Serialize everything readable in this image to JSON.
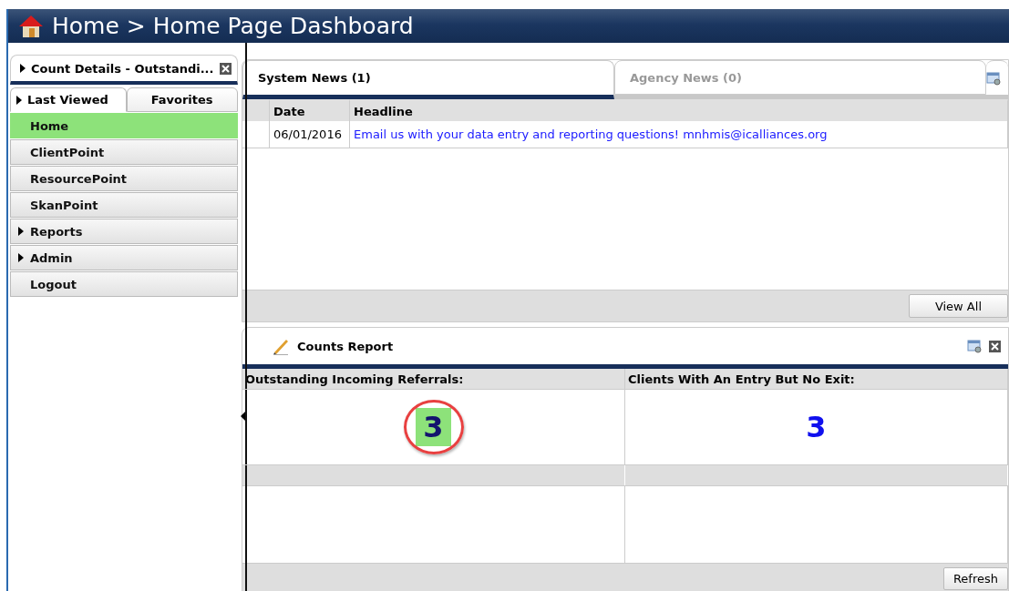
{
  "header": {
    "crumbs": [
      "Home",
      "Home Page Dashboard"
    ],
    "separator": ">"
  },
  "sidebar": {
    "recent": {
      "label": "Count Details - Outstandi..."
    },
    "tabs": [
      {
        "label": "Last Viewed",
        "selected": true
      },
      {
        "label": "Favorites",
        "selected": false
      }
    ],
    "items": [
      {
        "label": "Home",
        "kind": "link",
        "selected": true
      },
      {
        "label": "ClientPoint",
        "kind": "link",
        "selected": false
      },
      {
        "label": "ResourcePoint",
        "kind": "link",
        "selected": false
      },
      {
        "label": "SkanPoint",
        "kind": "link",
        "selected": false
      },
      {
        "label": "Reports",
        "kind": "group",
        "selected": false
      },
      {
        "label": "Admin",
        "kind": "group",
        "selected": false
      },
      {
        "label": "Logout",
        "kind": "link",
        "selected": false
      }
    ]
  },
  "news": {
    "tabs": [
      {
        "label": "System News (1)",
        "selected": true
      },
      {
        "label": "Agency News (0)",
        "selected": false
      }
    ],
    "columns": [
      "Date",
      "Headline"
    ],
    "rows": [
      {
        "date": "06/01/2016",
        "headline": "Email us with your data entry and reporting questions! mnhmis@icalliances.org"
      }
    ],
    "button": "View All"
  },
  "counts": {
    "title": "Counts Report",
    "items": [
      {
        "label": "Outstanding Incoming Referrals:",
        "value": "3",
        "highlighted": true
      },
      {
        "label": "Clients With An Entry But No Exit:",
        "value": "3",
        "highlighted": false
      }
    ],
    "button": "Refresh"
  }
}
